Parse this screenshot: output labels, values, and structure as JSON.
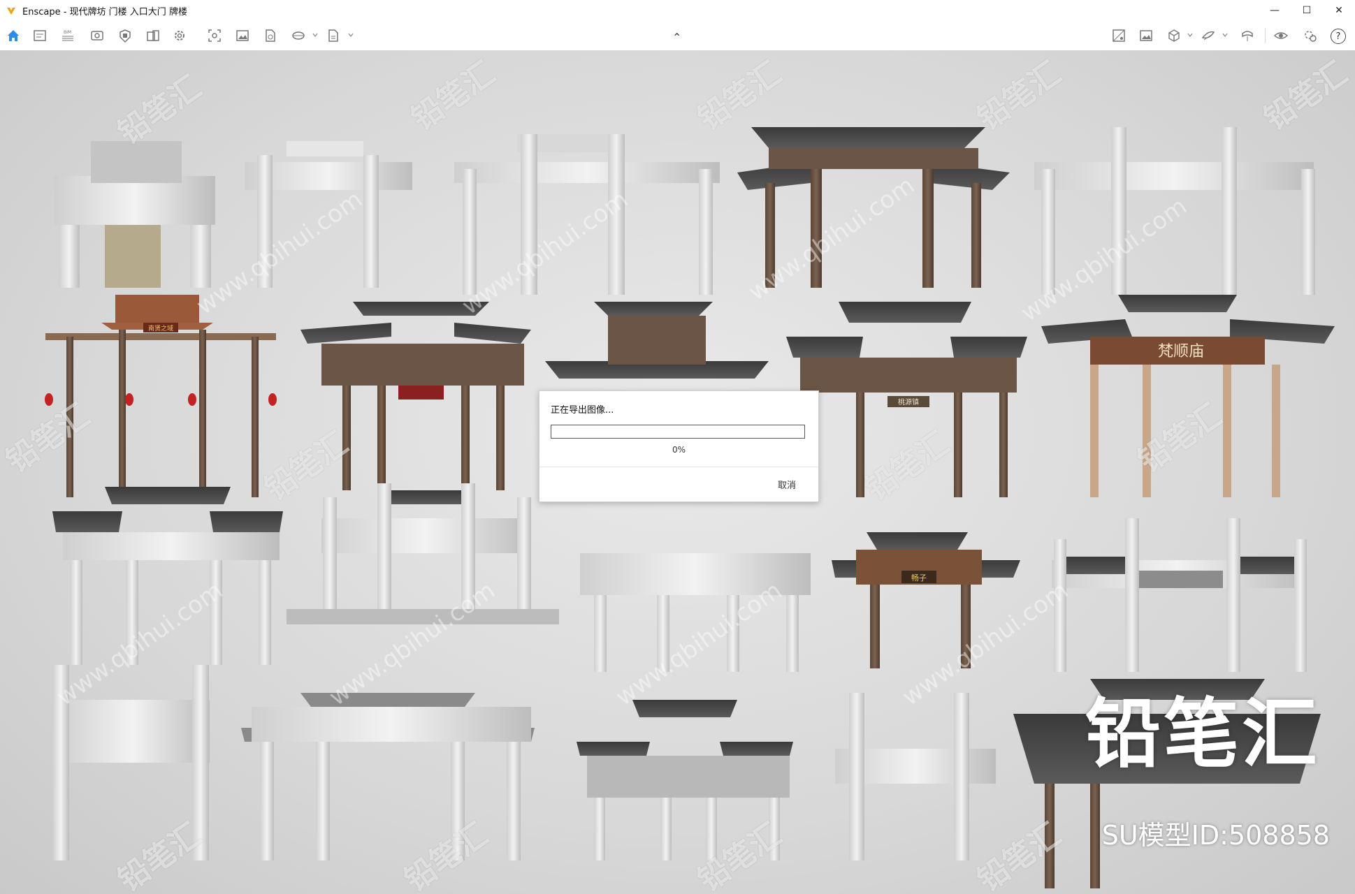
{
  "window": {
    "title": "Enscape - 现代牌坊 门楼 入口大门 牌楼",
    "minimize": "—",
    "maximize": "☐",
    "close": "✕"
  },
  "toolbar": {
    "left_icons": [
      "home-icon",
      "sketch-view-icon",
      "bim-icon",
      "visual-settings-icon",
      "asset-library-icon",
      "views-icon",
      "settings-gear-icon",
      "render-capture-icon",
      "screenshot-icon",
      "batch-export-icon",
      "panorama-icon",
      "export-dropdown-icon"
    ],
    "bim_label": "BIM",
    "collapse_caret": "⌃",
    "right_icons": [
      "materials-icon",
      "image-icon",
      "cube-icon",
      "layers-icon",
      "ar-icon",
      "eye-icon",
      "live-update-icon",
      "help-icon"
    ],
    "help_label": "?"
  },
  "viewport": {
    "watermark_text": "铅笔汇",
    "watermark_url": "www.qbihui.com",
    "brand": "铅笔汇",
    "model_id": "SU模型ID:508858",
    "sign_labels": [
      "南贤之域",
      "桃源镇",
      "梵顺庙",
      "畅子"
    ]
  },
  "dialog": {
    "message": "正在导出图像...",
    "progress": 0.0,
    "progress_text": "0%",
    "cancel_label": "取消"
  }
}
